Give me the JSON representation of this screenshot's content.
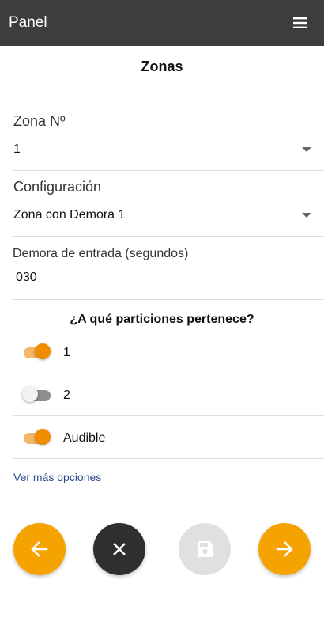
{
  "appbar": {
    "title": "Panel",
    "menu_icon": "menu-icon"
  },
  "page": {
    "title": "Zonas"
  },
  "zone_number": {
    "label": "Zona Nº",
    "value": "1"
  },
  "configuration": {
    "label": "Configuración",
    "value": "Zona con Demora 1"
  },
  "entry_delay": {
    "label": "Demora de entrada (segundos)",
    "value": "030"
  },
  "partitions": {
    "title": "¿A qué particiones pertenece?",
    "items": [
      {
        "label": "1",
        "on": true
      },
      {
        "label": "2",
        "on": false
      },
      {
        "label": "Audible",
        "on": true
      }
    ]
  },
  "more_options": "Ver más opciones",
  "actions": {
    "prev_icon": "arrow-left-icon",
    "cancel_icon": "close-icon",
    "save_icon": "floppy-disk-icon",
    "next_icon": "arrow-right-icon"
  },
  "colors": {
    "appbar": "#3d3d3d",
    "accent": "#f5a300",
    "switch_on": "#f08c00",
    "cancel": "#2e2f2e",
    "disabled": "#e0e0e0",
    "link": "#2a4a8a"
  }
}
